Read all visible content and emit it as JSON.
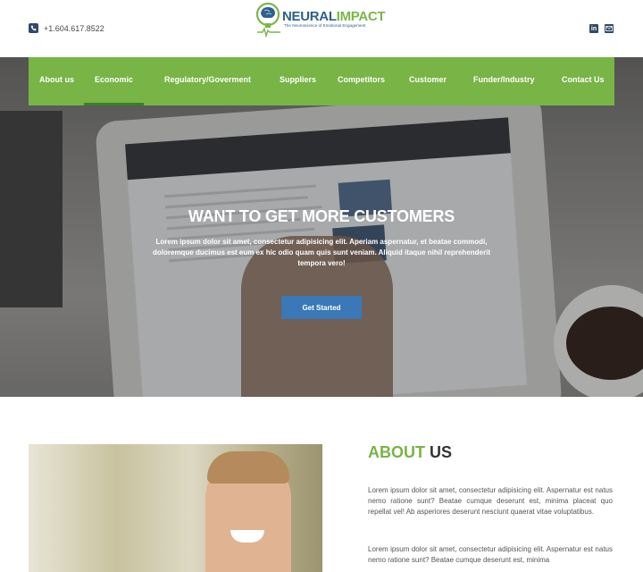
{
  "topbar": {
    "phone": "+1.604.617.8522",
    "logo_word1": "NEURAL",
    "logo_word2": "IMPACT",
    "logo_tagline": "The Neuroscience of Emotional Engagement",
    "social_icons": [
      "linkedin-icon",
      "mail-icon"
    ]
  },
  "nav": {
    "items": [
      {
        "label": "About us"
      },
      {
        "label": "Economic"
      },
      {
        "label": "Regulatory/Goverment"
      },
      {
        "label": "Suppliers"
      },
      {
        "label": "Competitors"
      },
      {
        "label": "Customer"
      },
      {
        "label": "Funder/Industry"
      },
      {
        "label": "Contact Us"
      }
    ],
    "active": "Economic"
  },
  "hero": {
    "title": "WANT TO GET MORE CUSTOMERS",
    "text": "Lorem ipsum dolor sit amet, consectetur adipisicing elit. Aperiam aspernatur, et beatae commodi, doloremque ducimus est eum ex hic odio quam quis sunt veniam. Aliquid itaque nihil reprehenderit tempora vero!",
    "cta_label": "Get Started"
  },
  "about": {
    "title_green": "ABOUT",
    "title_dark": "US",
    "paragraphs": [
      "Lorem ipsum dolor sit amet, consectetur adipisicing elit. Aspernatur est natus nemo ratione sunt? Beatae cumque deserunt est, minima placeat quo repellat vel! Ab asperiores deserunt nesciunt quaerat vitae voluptatibus.",
      "Lorem ipsum dolor sit amet, consectetur adipisicing elit. Aspernatur est natus nemo ratione sunt? Beatae cumque deserunt est, minima"
    ]
  },
  "colors": {
    "brand_green": "#78b446",
    "brand_blue": "#2f5f8a",
    "cta_blue": "#3a78b8"
  }
}
